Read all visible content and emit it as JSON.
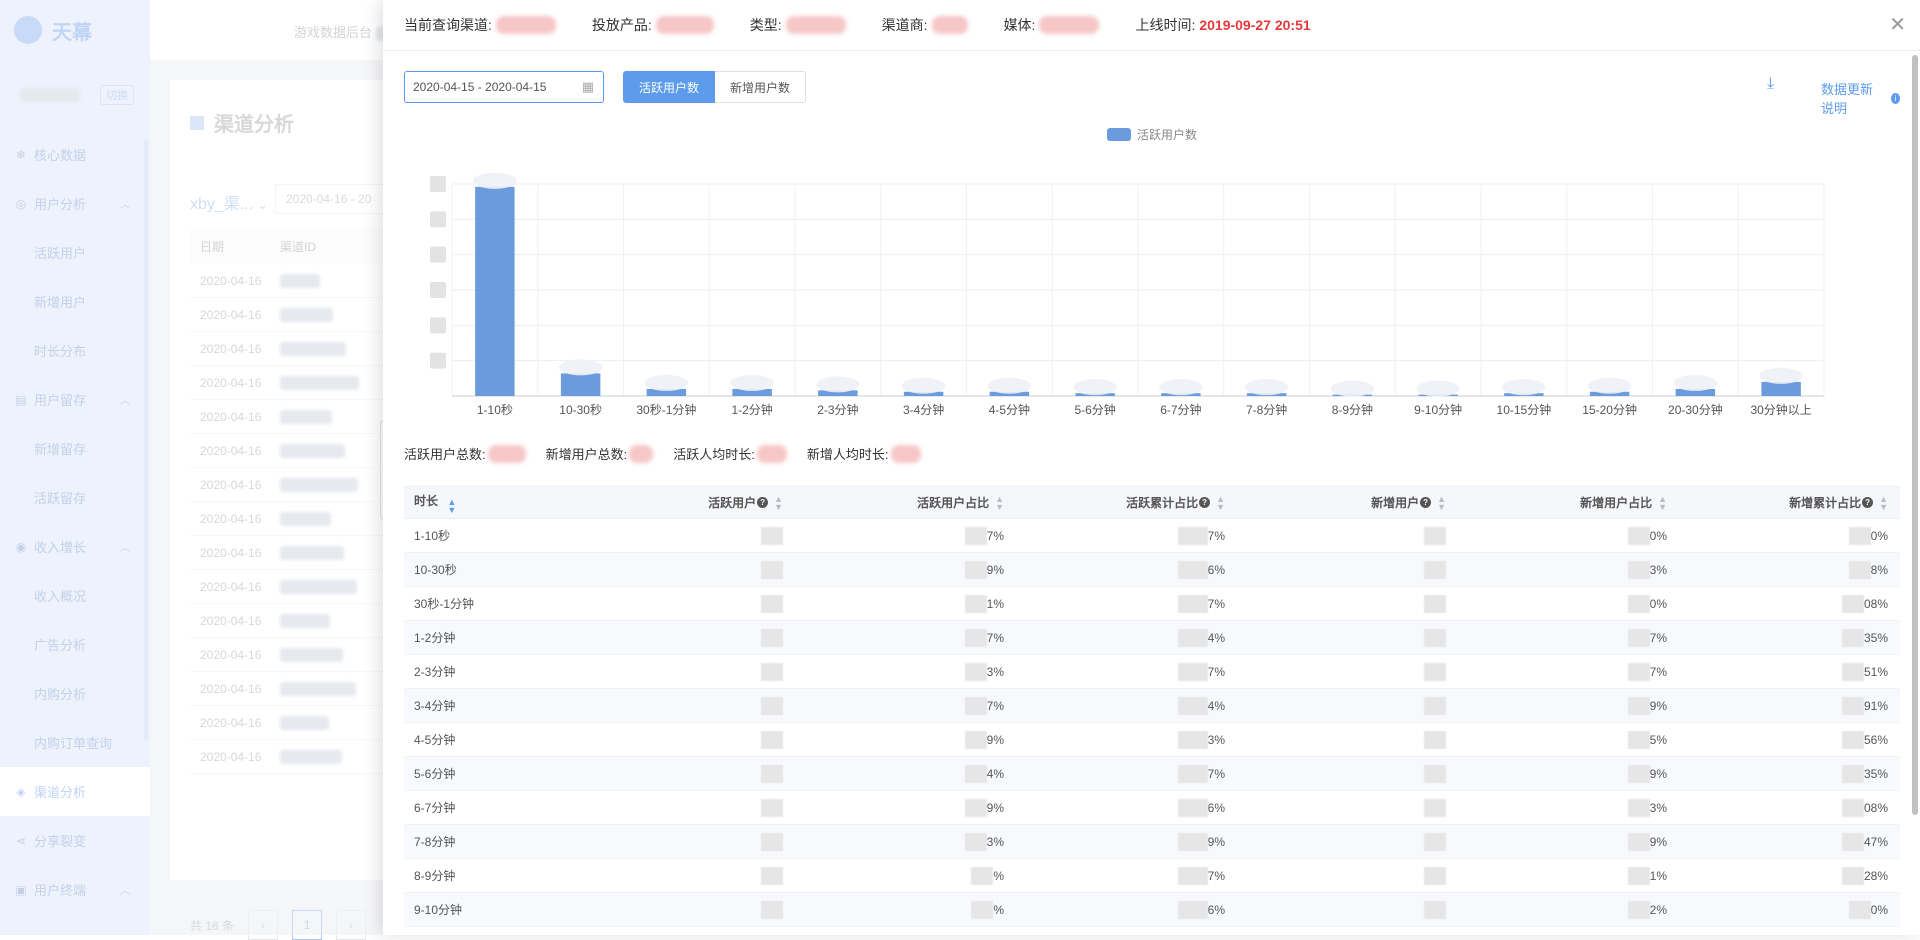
{
  "app": {
    "logo_text": "天幕",
    "topbar_title": "游戏数据后台",
    "user_switch": "切换",
    "page_title": "渠道分析",
    "bg_filter": "xby_渠...",
    "bg_date": "2020-04-16 - 20",
    "bg_table": {
      "headers": [
        "日期",
        "渠道ID"
      ],
      "rows": [
        "2020-04-16",
        "2020-04-16",
        "2020-04-16",
        "2020-04-16",
        "2020-04-16",
        "2020-04-16",
        "2020-04-16",
        "2020-04-16",
        "2020-04-16",
        "2020-04-16",
        "2020-04-16",
        "2020-04-16",
        "2020-04-16",
        "2020-04-16",
        "2020-04-16"
      ],
      "total": "共 16 条",
      "page": "1"
    },
    "nav": [
      {
        "label": "核心数据",
        "icon": "snowflake-icon",
        "type": "top"
      },
      {
        "label": "用户分析",
        "icon": "user-icon",
        "type": "top",
        "expanded": true
      },
      {
        "label": "活跃用户",
        "type": "sub"
      },
      {
        "label": "新增用户",
        "type": "sub"
      },
      {
        "label": "时长分布",
        "type": "sub"
      },
      {
        "label": "用户留存",
        "icon": "calendar-icon",
        "type": "top",
        "expanded": true
      },
      {
        "label": "新增留存",
        "type": "sub"
      },
      {
        "label": "活跃留存",
        "type": "sub"
      },
      {
        "label": "收入增长",
        "icon": "coin-icon",
        "type": "top",
        "expanded": true
      },
      {
        "label": "收入概况",
        "type": "sub"
      },
      {
        "label": "广告分析",
        "type": "sub"
      },
      {
        "label": "内购分析",
        "type": "sub"
      },
      {
        "label": "内购订单查询",
        "type": "sub"
      },
      {
        "label": "渠道分析",
        "icon": "diamond-icon",
        "type": "top",
        "active": true
      },
      {
        "label": "分享裂变",
        "icon": "share-icon",
        "type": "top"
      },
      {
        "label": "用户终端",
        "icon": "device-icon",
        "type": "top",
        "expanded": true
      }
    ]
  },
  "drawer": {
    "header": {
      "channel_label": "当前查询渠道:",
      "product_label": "投放产品:",
      "type_label": "类型:",
      "vendor_label": "渠道商:",
      "media_label": "媒体:",
      "online_label": "上线时间:",
      "online_time": "2019-09-27 20:51"
    },
    "date_range": "2020-04-15 - 2020-04-15",
    "tabs": [
      "活跃用户数",
      "新增用户数"
    ],
    "active_tab": 0,
    "update_note": "数据更新说明",
    "stats": {
      "active_total_label": "活跃用户总数:",
      "new_total_label": "新增用户总数:",
      "active_avg_label": "活跃人均时长:",
      "new_avg_label": "新增人均时长:"
    },
    "table": {
      "headers": [
        "时长",
        "活跃用户",
        "活跃用户占比",
        "活跃累计占比",
        "新增用户",
        "新增用户占比",
        "新增累计占比"
      ],
      "rows": [
        {
          "d": "1-10秒",
          "c2": "7%",
          "c3": "7%",
          "c5": "0%",
          "c6": "0%"
        },
        {
          "d": "10-30秒",
          "c2": "9%",
          "c3": "6%",
          "c5": "3%",
          "c6": "8%"
        },
        {
          "d": "30秒-1分钟",
          "c2": "1%",
          "c3": "7%",
          "c5": "0%",
          "c6": "08%"
        },
        {
          "d": "1-2分钟",
          "c2": "7%",
          "c3": "4%",
          "c5": "7%",
          "c6": "35%"
        },
        {
          "d": "2-3分钟",
          "c2": "3%",
          "c3": "7%",
          "c5": "7%",
          "c6": "51%"
        },
        {
          "d": "3-4分钟",
          "c2": "7%",
          "c3": "4%",
          "c5": "9%",
          "c6": "91%"
        },
        {
          "d": "4-5分钟",
          "c2": "9%",
          "c3": "3%",
          "c5": "5%",
          "c6": "56%"
        },
        {
          "d": "5-6分钟",
          "c2": "4%",
          "c3": "7%",
          "c5": "9%",
          "c6": "35%"
        },
        {
          "d": "6-7分钟",
          "c2": "9%",
          "c3": "6%",
          "c5": "3%",
          "c6": "08%"
        },
        {
          "d": "7-8分钟",
          "c2": "3%",
          "c3": "9%",
          "c5": "9%",
          "c6": "47%"
        },
        {
          "d": "8-9分钟",
          "c2": "%",
          "c3": "7%",
          "c5": "1%",
          "c6": "28%"
        },
        {
          "d": "9-10分钟",
          "c2": "%",
          "c3": "6%",
          "c5": "2%",
          "c6": "0%"
        }
      ]
    }
  },
  "chart_data": {
    "type": "bar",
    "legend": "活跃用户数",
    "legend_position": "top-center",
    "categories": [
      "1-10秒",
      "10-30秒",
      "30秒-1分钟",
      "1-2分钟",
      "2-3分钟",
      "3-4分钟",
      "4-5分钟",
      "5-6分钟",
      "6-7分钟",
      "7-8分钟",
      "8-9分钟",
      "9-10分钟",
      "10-15分钟",
      "15-20分钟",
      "20-30分钟",
      "30分钟以上"
    ],
    "series": [
      {
        "name": "活跃用户数",
        "values": [
          148,
          16,
          5,
          5,
          4,
          3,
          3,
          2,
          2,
          2,
          1,
          1,
          2,
          3,
          5,
          10
        ]
      }
    ],
    "ylim": [
      0,
      150
    ],
    "grid": true,
    "color": "#6a9bdc"
  }
}
